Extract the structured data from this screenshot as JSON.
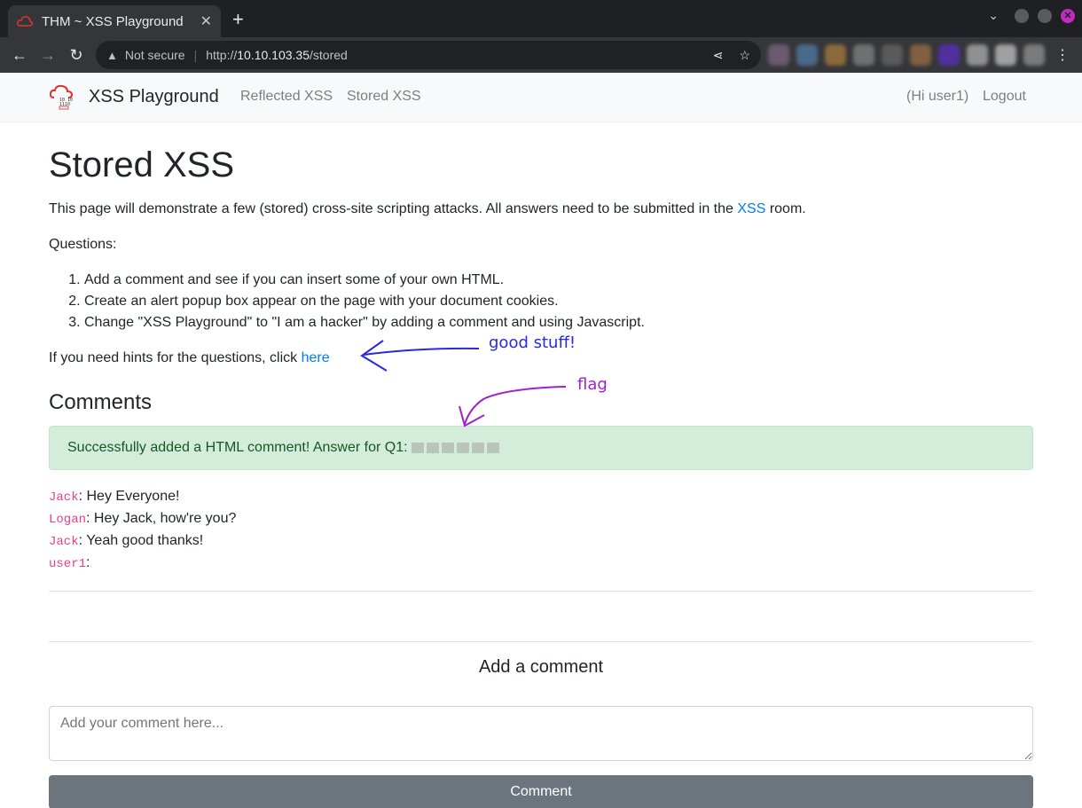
{
  "browser": {
    "tab_title": "THM ~ XSS Playground",
    "tab_close": "✕",
    "new_tab": "+",
    "security": "Not secure",
    "url_prefix": "http://",
    "url_host": "10.10.103.35",
    "url_path": "/stored"
  },
  "navbar": {
    "brand": "XSS Playground",
    "links": [
      "Reflected XSS",
      "Stored XSS"
    ],
    "greeting": "(Hi user1)",
    "logout": "Logout"
  },
  "page": {
    "title": "Stored XSS",
    "intro_before": "This page will demonstrate a few (stored) cross-site scripting attacks. All answers need to be submitted in the ",
    "intro_link": "XSS",
    "intro_after": " room.",
    "questions_label": "Questions:",
    "questions": [
      "Add a comment and see if you can insert some of your own HTML.",
      "Create an alert popup box appear on the page with your document cookies.",
      "Change \"XSS Playground\" to \"I am a hacker\" by adding a comment and using Javascript."
    ],
    "hint_text": "If you need hints for the questions, click ",
    "hint_link": "here"
  },
  "comments": {
    "heading": "Comments",
    "alert": "Successfully added a HTML comment! Answer for Q1:",
    "items": [
      {
        "user": "Jack",
        "text": ": Hey Everyone!"
      },
      {
        "user": "Logan",
        "text": ": Hey Jack, how're you?"
      },
      {
        "user": "Jack",
        "text": ": Yeah good thanks!"
      },
      {
        "user": "user1",
        "text": ":"
      }
    ]
  },
  "form": {
    "heading": "Add a comment",
    "placeholder": "Add your comment here...",
    "button": "Comment"
  },
  "annotations": {
    "good": "good stuff!",
    "flag": "flag",
    "good_color": "#2a2ad8",
    "flag_color": "#a020d0"
  }
}
